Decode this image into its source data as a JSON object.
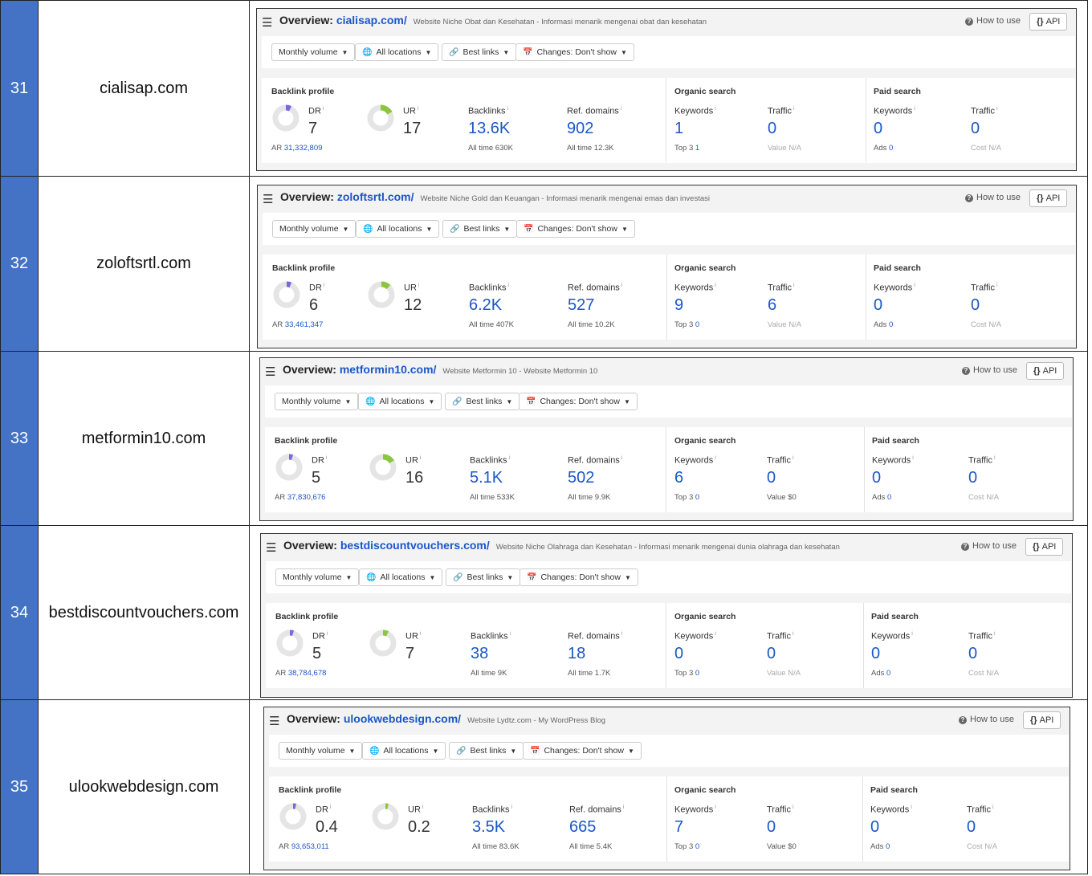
{
  "colors": {
    "row_number_bg": "#4472c4",
    "link_blue": "#1a56c9",
    "dr_donut": "#7b68d6",
    "ur_donut": "#8cc63f"
  },
  "ui": {
    "overview_label": "Overview:",
    "how_to_use": "How to use",
    "api": "API",
    "filters": {
      "volume": "Monthly volume",
      "locations": "All locations",
      "links": "Best links",
      "changes": "Changes: Don't show"
    },
    "sections": {
      "backlink_profile": "Backlink profile",
      "organic_search": "Organic search",
      "paid_search": "Paid search"
    },
    "labels": {
      "dr": "DR",
      "ur": "UR",
      "backlinks": "Backlinks",
      "ref_domains": "Ref. domains",
      "keywords": "Keywords",
      "traffic": "Traffic",
      "ar": "AR",
      "all_time": "All time",
      "top3": "Top 3",
      "value": "Value",
      "ads": "Ads",
      "cost": "Cost"
    },
    "icons": {
      "menu": "hamburger-menu-icon",
      "help": "question-circle-icon",
      "api": "curly-braces-icon",
      "globe": "globe-icon",
      "link": "link-icon",
      "calendar": "calendar-icon",
      "caret": "caret-down-icon"
    }
  },
  "rows": [
    {
      "number": "31",
      "domain": "cialisap.com",
      "site": "cialisap.com/",
      "description": "Website Niche Obat dan Kesehatan - Informasi menarik mengenai obat dan kesehatan",
      "dr": "7",
      "dr_fraction": 0.07,
      "ur": "17",
      "ur_fraction": 0.17,
      "ar": "31,332,809",
      "backlinks": "13.6K",
      "backlinks_all_time": "630K",
      "ref_domains": "902",
      "ref_domains_all_time": "12.3K",
      "organic_keywords": "1",
      "organic_top3": "1",
      "organic_traffic": "0",
      "organic_value": "N/A",
      "paid_keywords": "0",
      "paid_ads": "0",
      "paid_traffic": "0",
      "paid_cost": "N/A"
    },
    {
      "number": "32",
      "domain": "zoloftsrtl.com",
      "site": "zoloftsrtl.com/",
      "description": "Website Niche Gold dan Keuangan - Informasi menarik mengenai emas dan investasi",
      "dr": "6",
      "dr_fraction": 0.06,
      "ur": "12",
      "ur_fraction": 0.12,
      "ar": "33,461,347",
      "backlinks": "6.2K",
      "backlinks_all_time": "407K",
      "ref_domains": "527",
      "ref_domains_all_time": "10.2K",
      "organic_keywords": "9",
      "organic_top3": "0",
      "organic_traffic": "6",
      "organic_value": "N/A",
      "paid_keywords": "0",
      "paid_ads": "0",
      "paid_traffic": "0",
      "paid_cost": "N/A"
    },
    {
      "number": "33",
      "domain": "metformin10.com",
      "site": "metformin10.com/",
      "description": "Website Metformin 10 - Website Metformin 10",
      "dr": "5",
      "dr_fraction": 0.05,
      "ur": "16",
      "ur_fraction": 0.16,
      "ar": "37,830,676",
      "backlinks": "5.1K",
      "backlinks_all_time": "533K",
      "ref_domains": "502",
      "ref_domains_all_time": "9.9K",
      "organic_keywords": "6",
      "organic_top3": "0",
      "organic_traffic": "0",
      "organic_value": "$0",
      "paid_keywords": "0",
      "paid_ads": "0",
      "paid_traffic": "0",
      "paid_cost": "N/A"
    },
    {
      "number": "34",
      "domain": "bestdiscountvouchers.com",
      "site": "bestdiscountvouchers.com/",
      "description": "Website Niche Olahraga dan Kesehatan - Informasi menarik mengenai dunia olahraga dan kesehatan",
      "dr": "5",
      "dr_fraction": 0.05,
      "ur": "7",
      "ur_fraction": 0.07,
      "ar": "38,784,678",
      "backlinks": "38",
      "backlinks_all_time": "9K",
      "ref_domains": "18",
      "ref_domains_all_time": "1.7K",
      "organic_keywords": "0",
      "organic_top3": "0",
      "organic_traffic": "0",
      "organic_value": "N/A",
      "paid_keywords": "0",
      "paid_ads": "0",
      "paid_traffic": "0",
      "paid_cost": "N/A"
    },
    {
      "number": "35",
      "domain": "ulookwebdesign.com",
      "site": "ulookwebdesign.com/",
      "description": "Website Lydtz.com - My WordPress Blog",
      "dr": "0.4",
      "dr_fraction": 0.004,
      "ur": "0.2",
      "ur_fraction": 0.002,
      "ar": "93,653,011",
      "backlinks": "3.5K",
      "backlinks_all_time": "83.6K",
      "ref_domains": "665",
      "ref_domains_all_time": "5.4K",
      "organic_keywords": "7",
      "organic_top3": "0",
      "organic_traffic": "0",
      "organic_value": "$0",
      "paid_keywords": "0",
      "paid_ads": "0",
      "paid_traffic": "0",
      "paid_cost": "N/A"
    }
  ]
}
